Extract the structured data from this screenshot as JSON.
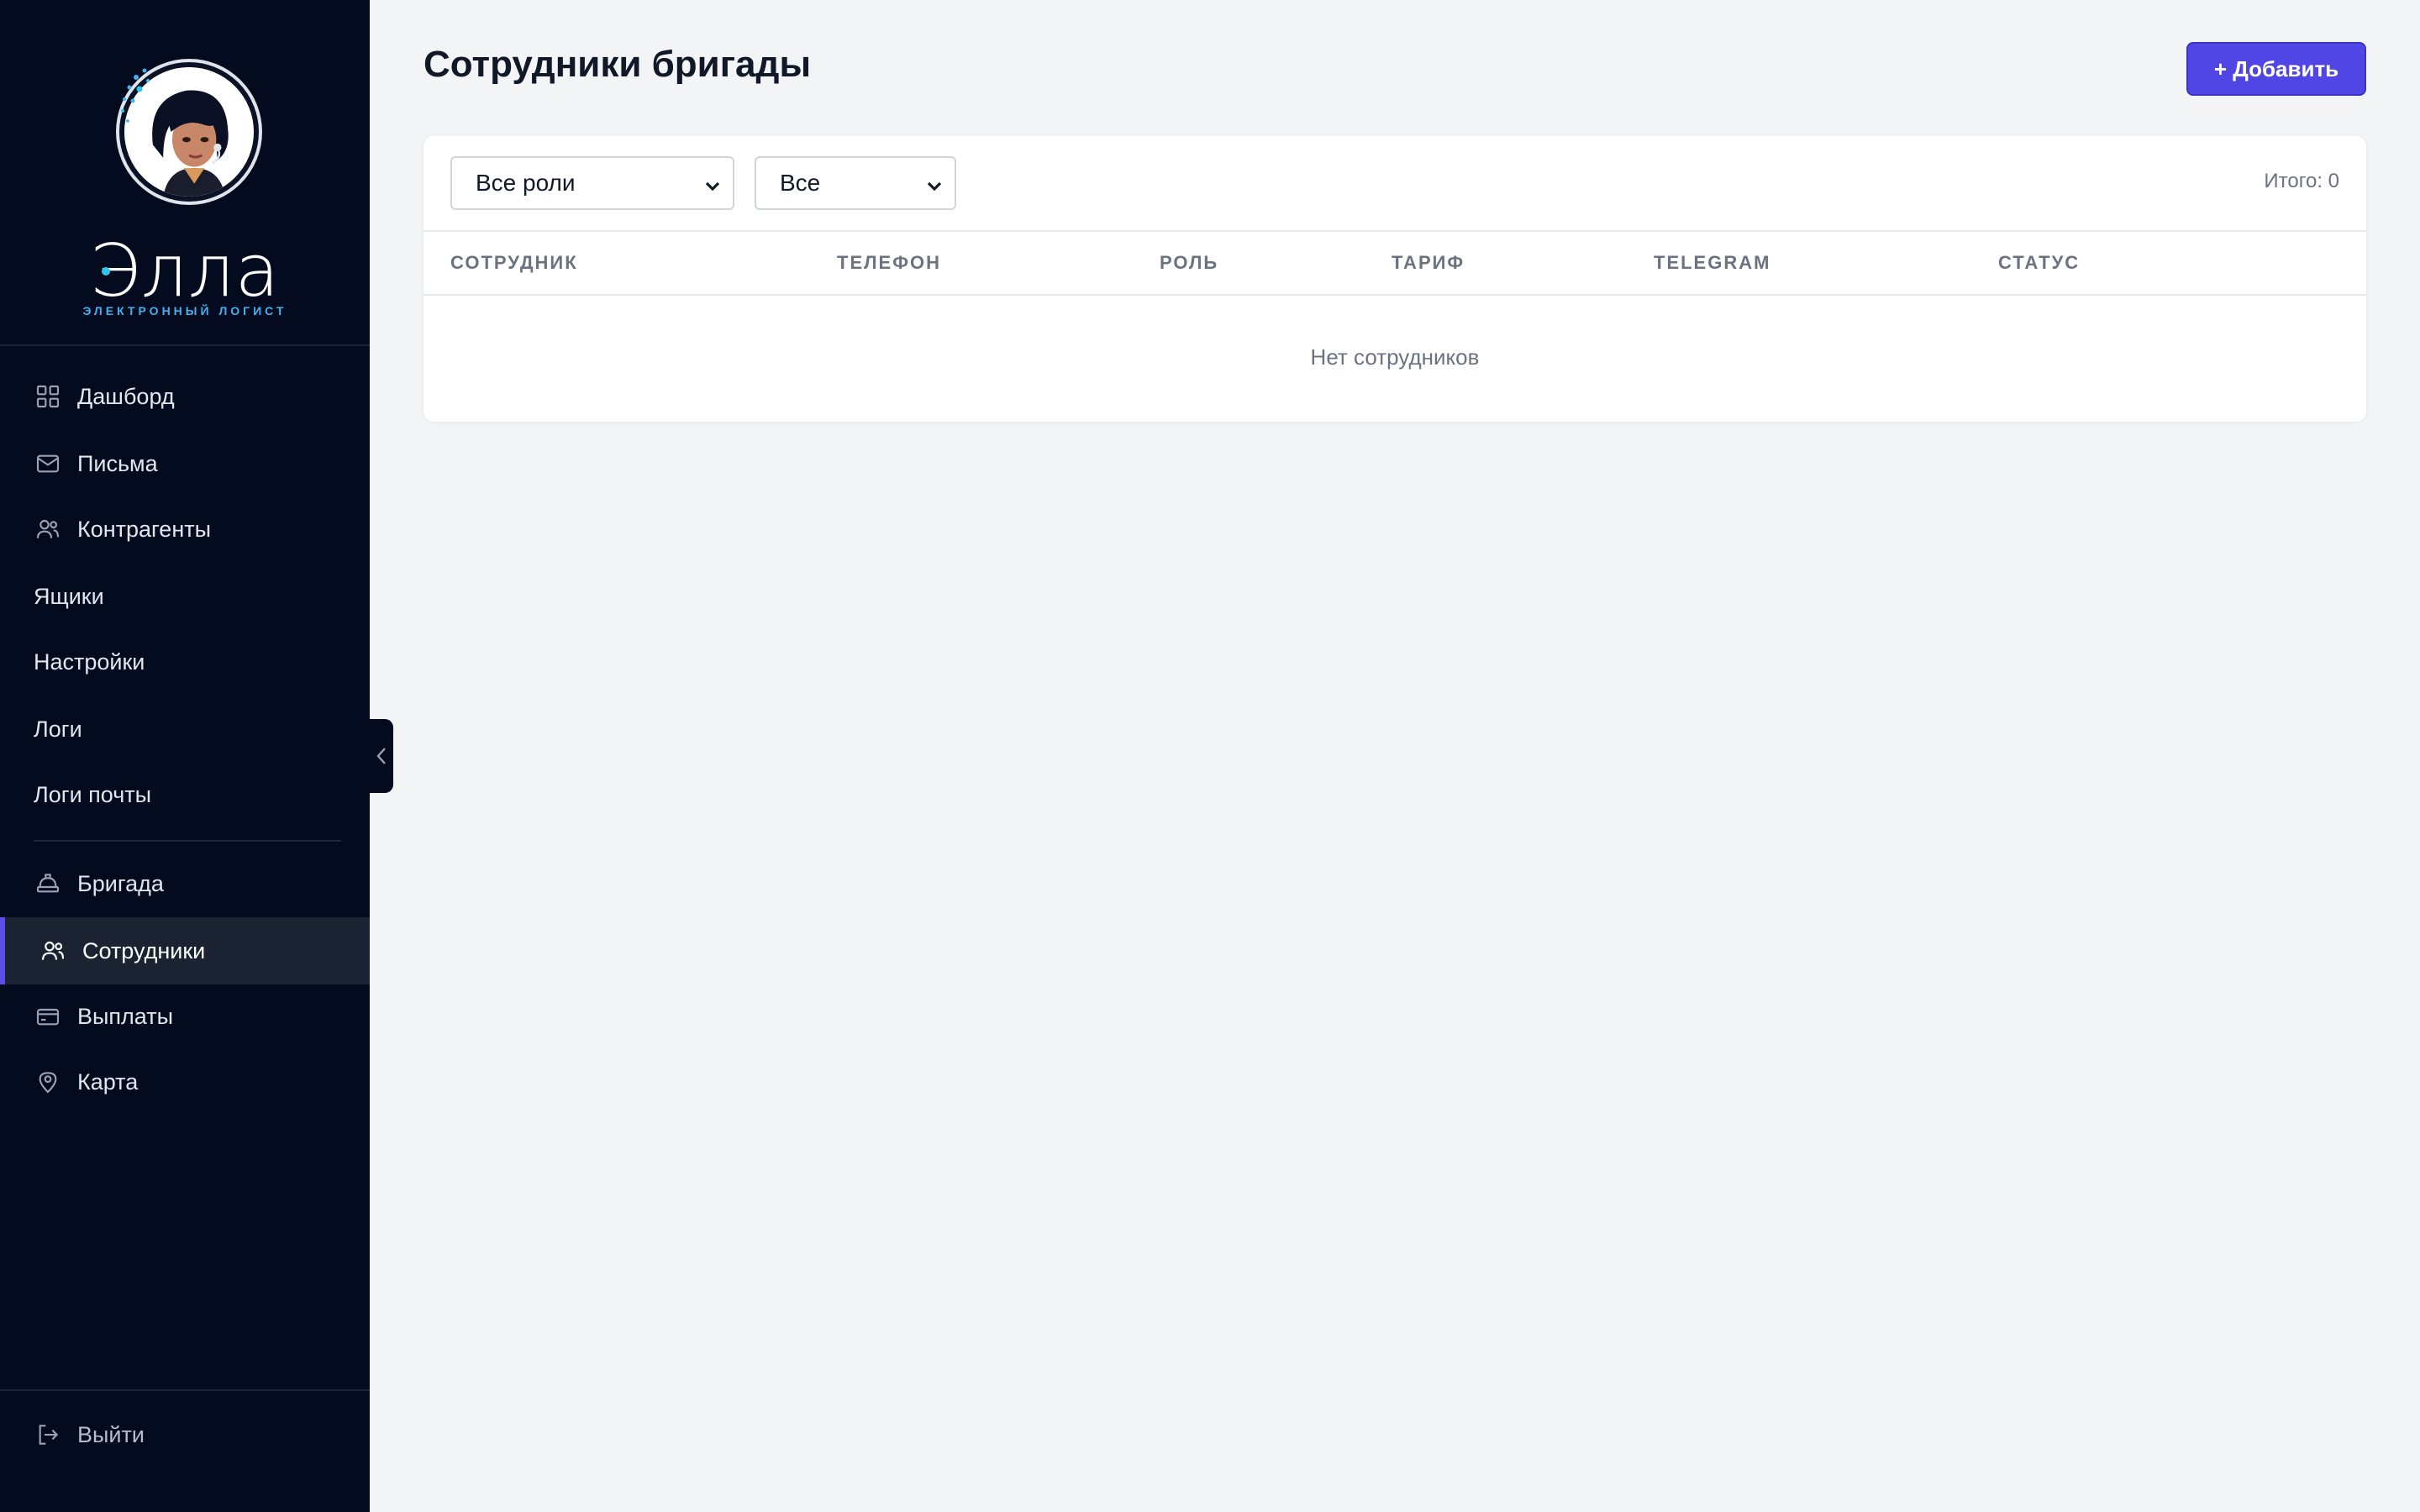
{
  "brand": {
    "name": "Элла",
    "subtitle": "ЭЛЕКТРОННЫЙ ЛОГИСТ"
  },
  "sidebar": {
    "items": [
      {
        "label": "Дашборд",
        "icon": "grid-icon"
      },
      {
        "label": "Письма",
        "icon": "mail-icon"
      },
      {
        "label": "Контрагенты",
        "icon": "users-icon"
      },
      {
        "label": "Ящики",
        "icon": ""
      },
      {
        "label": "Настройки",
        "icon": ""
      },
      {
        "label": "Логи",
        "icon": ""
      },
      {
        "label": "Логи почты",
        "icon": ""
      },
      {
        "label": "Бригада",
        "icon": "helmet-icon"
      },
      {
        "label": "Сотрудники",
        "icon": "users-icon",
        "active": true
      },
      {
        "label": "Выплаты",
        "icon": "card-icon"
      },
      {
        "label": "Карта",
        "icon": "map-pin-icon"
      }
    ],
    "logout": {
      "label": "Выйти",
      "icon": "logout-icon"
    }
  },
  "page": {
    "title": "Сотрудники бригады",
    "add_button": "+ Добавить"
  },
  "filters": {
    "role": {
      "value": "Все роли"
    },
    "status": {
      "value": "Все"
    },
    "total": "Итого: 0"
  },
  "table": {
    "columns": [
      "СОТРУДНИК",
      "ТЕЛЕФОН",
      "РОЛЬ",
      "ТАРИФ",
      "TELEGRAM",
      "СТАТУС"
    ],
    "empty_text": "Нет сотрудников"
  },
  "colors": {
    "sidebar_bg": "#050b1e",
    "accent": "#4f46e5",
    "page_bg": "#f3f4f6"
  }
}
